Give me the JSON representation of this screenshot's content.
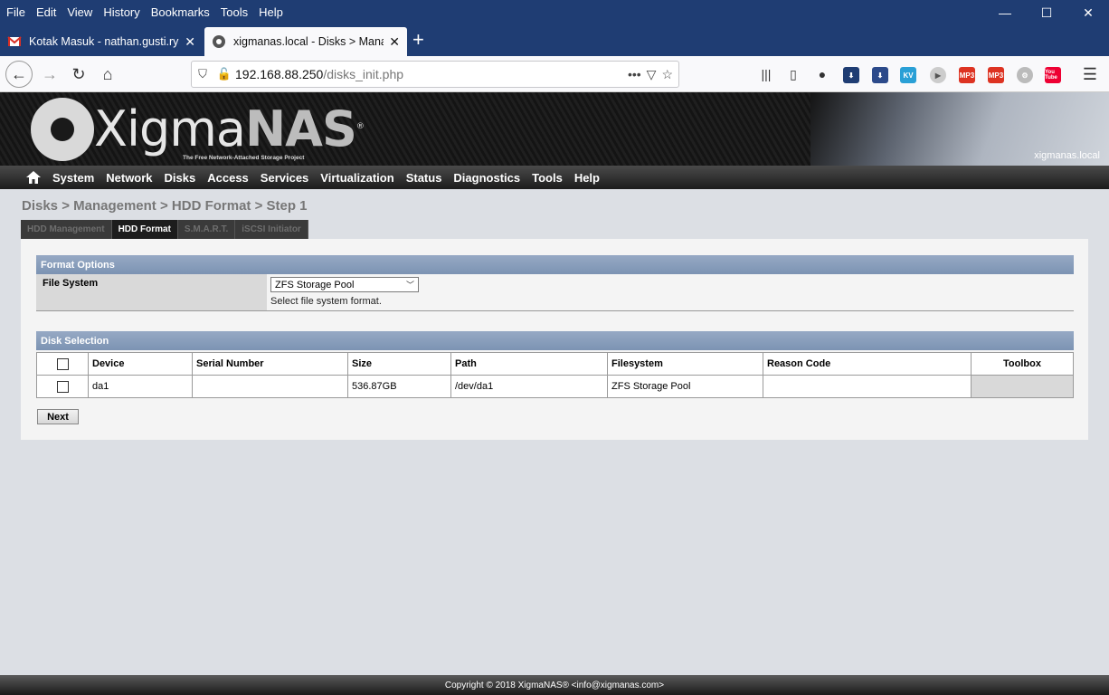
{
  "menubar": {
    "items": [
      "File",
      "Edit",
      "View",
      "History",
      "Bookmarks",
      "Tools",
      "Help"
    ]
  },
  "tabs": [
    {
      "title": "Kotak Masuk - nathan.gusti.rya",
      "icon": "gmail-icon"
    },
    {
      "title": "xigmanas.local - Disks > Manag",
      "icon": "xigmanas-icon"
    }
  ],
  "url": {
    "host": "192.168.88.250",
    "path": "/disks_init.php"
  },
  "extensions": [
    "KV",
    "MP3",
    "MP3",
    "You Tube"
  ],
  "banner": {
    "logo_main": "Xigma",
    "logo_accent": "NAS",
    "registered": "®",
    "tagline": "The Free Network-Attached Storage Project",
    "hostname": "xigmanas.local"
  },
  "nav": [
    "System",
    "Network",
    "Disks",
    "Access",
    "Services",
    "Virtualization",
    "Status",
    "Diagnostics",
    "Tools",
    "Help"
  ],
  "breadcrumb": "Disks > Management > HDD Format > Step 1",
  "page_tabs": [
    {
      "label": "HDD Management",
      "active": false
    },
    {
      "label": "HDD Format",
      "active": true
    },
    {
      "label": "S.M.A.R.T.",
      "active": false
    },
    {
      "label": "iSCSI Initiator",
      "active": false
    }
  ],
  "format_options": {
    "header": "Format Options",
    "label": "File System",
    "selected": "ZFS Storage Pool",
    "hint": "Select file system format."
  },
  "disk_selection": {
    "header": "Disk Selection",
    "columns": [
      "Device",
      "Serial Number",
      "Size",
      "Path",
      "Filesystem",
      "Reason Code",
      "Toolbox"
    ],
    "rows": [
      {
        "device": "da1",
        "serial": "",
        "size": "536.87GB",
        "path": "/dev/da1",
        "filesystem": "ZFS Storage Pool",
        "reason": ""
      }
    ]
  },
  "next_label": "Next",
  "footer": "Copyright © 2018 XigmaNAS® <info@xigmanas.com>",
  "colors": {
    "chrome": "#1f3d73",
    "section_header": "#8aa0bd",
    "panel": "#f4f4f4"
  }
}
